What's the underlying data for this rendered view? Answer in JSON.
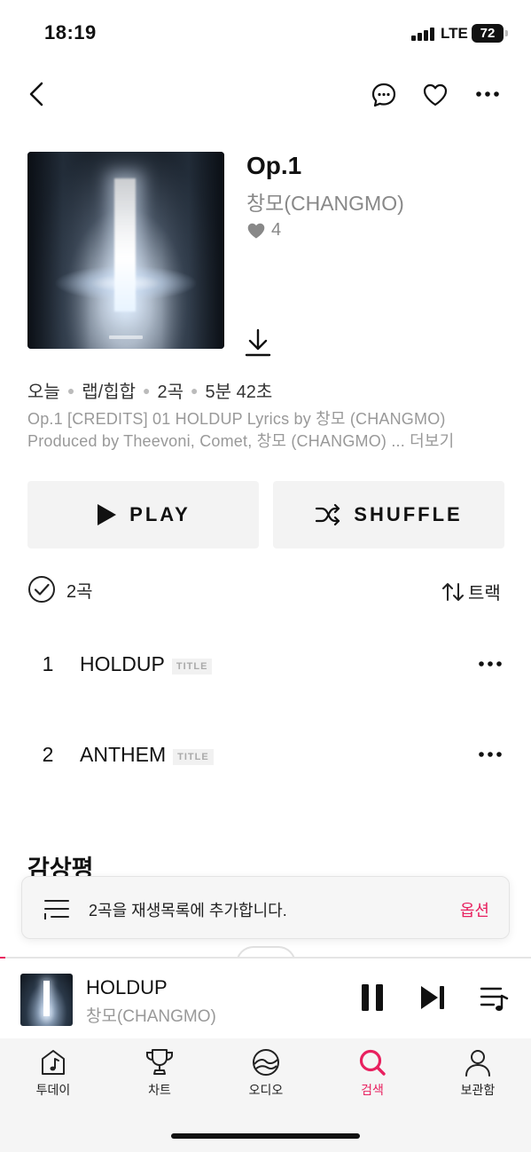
{
  "status": {
    "time": "18:19",
    "network": "LTE",
    "battery": "72"
  },
  "album": {
    "title": "Op.1",
    "artist": "창모(CHANGMO)",
    "likes": "4",
    "meta": [
      "오늘",
      "랩/힙합",
      "2곡",
      "5분 42초"
    ],
    "description": "Op.1 [CREDITS] 01 HOLDUP Lyrics by 창모 (CHANGMO) Produced by Theevoni, Comet, 창모 (CHANGMO)",
    "more_label": "... 더보기"
  },
  "actions": {
    "play_label": "PLAY",
    "shuffle_label": "SHUFFLE"
  },
  "tracklist": {
    "count_label": "2곡",
    "sort_label": "트랙",
    "tracks": [
      {
        "number": "1",
        "title": "HOLDUP",
        "badge": "TITLE"
      },
      {
        "number": "2",
        "title": "ANTHEM",
        "badge": "TITLE"
      }
    ]
  },
  "reviews": {
    "heading": "감상평"
  },
  "toast": {
    "message": "2곡을 재생목록에 추가합니다.",
    "option_label": "옵션"
  },
  "player": {
    "title": "HOLDUP",
    "artist": "창모(CHANGMO)",
    "progress": 0.01
  },
  "tabs": [
    {
      "label": "투데이",
      "icon": "music-note-icon",
      "active": false
    },
    {
      "label": "차트",
      "icon": "trophy-icon",
      "active": false
    },
    {
      "label": "오디오",
      "icon": "audio-icon",
      "active": false
    },
    {
      "label": "검색",
      "icon": "search-icon",
      "active": true
    },
    {
      "label": "보관함",
      "icon": "person-icon",
      "active": false
    }
  ],
  "colors": {
    "accent": "#e8205f",
    "secondary_text": "#999999",
    "button_bg": "#f3f3f3"
  }
}
